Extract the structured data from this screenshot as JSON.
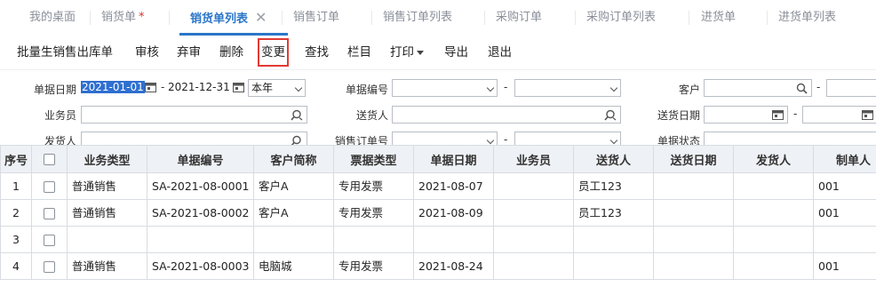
{
  "tabs": [
    {
      "label": "我的桌面"
    },
    {
      "label": "销货单",
      "modified_mark": "*"
    },
    {
      "label": "销货单列表",
      "close": "✕"
    },
    {
      "label": "销售订单"
    },
    {
      "label": "销售订单列表"
    },
    {
      "label": "采购订单"
    },
    {
      "label": "采购订单列表"
    },
    {
      "label": "进货单"
    },
    {
      "label": "进货单列表"
    }
  ],
  "toolbar": {
    "batch_out": "批量生销售出库单",
    "audit": "审核",
    "unaudit": "弃审",
    "delete": "删除",
    "change": "变更",
    "search": "查找",
    "columns": "栏目",
    "print": "打印",
    "export": "导出",
    "exit": "退出"
  },
  "filters": {
    "doc_date_label": "单据日期",
    "date_from": "2021-01-01",
    "date_to": "2021-12-31",
    "period": "本年",
    "doc_no_label": "单据编号",
    "customer_label": "客户",
    "salesman_label": "业务员",
    "deliverer_label": "送货人",
    "delivery_date_label": "送货日期",
    "shipper_label": "发货人",
    "sales_order_no_label": "销售订单号",
    "doc_status_label": "单据状态",
    "dash": "-"
  },
  "table": {
    "headers": [
      "序号",
      "",
      "业务类型",
      "单据编号",
      "客户简称",
      "票据类型",
      "单据日期",
      "业务员",
      "送货人",
      "送货日期",
      "发货人",
      "制单人"
    ],
    "rows": [
      {
        "no": "1",
        "type": "普通销售",
        "doc_no": "SA-2021-08-0001",
        "customer": "客户A",
        "invoice": "专用发票",
        "date": "2021-08-07",
        "salesman": "",
        "deliverer": "员工123",
        "delivery_date": "",
        "shipper": "",
        "maker": "001"
      },
      {
        "no": "2",
        "type": "普通销售",
        "doc_no": "SA-2021-08-0002",
        "customer": "客户A",
        "invoice": "专用发票",
        "date": "2021-08-09",
        "salesman": "",
        "deliverer": "员工123",
        "delivery_date": "",
        "shipper": "",
        "maker": "001"
      },
      {
        "no": "3",
        "type": "",
        "doc_no": "",
        "customer": "",
        "invoice": "",
        "date": "",
        "salesman": "",
        "deliverer": "",
        "delivery_date": "",
        "shipper": "",
        "maker": ""
      },
      {
        "no": "4",
        "type": "普通销售",
        "doc_no": "SA-2021-08-0003",
        "customer": "电脑城",
        "invoice": "专用发票",
        "date": "2021-08-24",
        "salesman": "",
        "deliverer": "",
        "delivery_date": "",
        "shipper": "",
        "maker": "001"
      }
    ]
  },
  "colors": {
    "accent": "#2b76c9",
    "highlight": "#e23a35",
    "header_bg": "#eef1f5"
  }
}
